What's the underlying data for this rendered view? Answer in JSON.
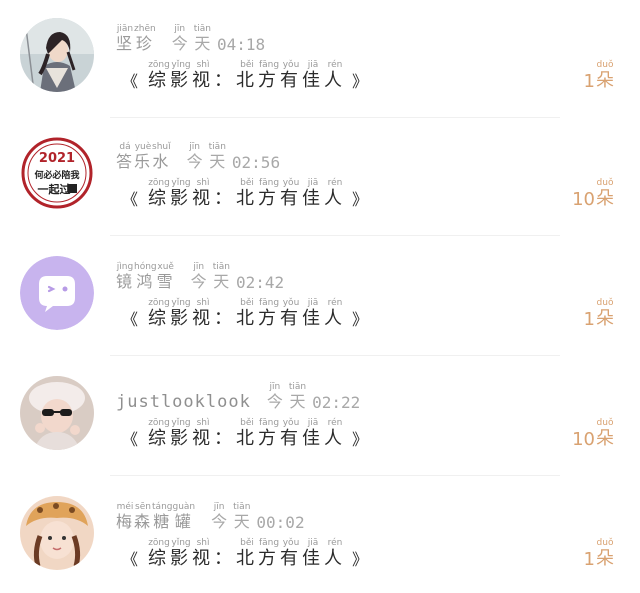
{
  "rows": [
    {
      "name": "坚珍",
      "name_pinyin": [
        "jiān",
        "zhēn"
      ],
      "name_chars": [
        "坚",
        "珍"
      ],
      "time_label": "今天",
      "time_pinyin": [
        "jīn",
        "tiān"
      ],
      "time_chars": [
        "今",
        "天"
      ],
      "timestamp": "04:18",
      "title_open": "《",
      "title_close": "》",
      "title_chars": [
        "综",
        "影",
        "视",
        "：",
        "北",
        "方",
        "有",
        "佳",
        "人"
      ],
      "title_pinyin": [
        "zōng",
        "yǐng",
        "shì",
        "",
        "běi",
        "fāng",
        "yǒu",
        "jiā",
        "rén"
      ],
      "count_number": "1",
      "count_unit": "朵",
      "count_unit_pinyin": "duǒ",
      "avatar_icon": "anime-portrait-avatar"
    },
    {
      "name": "答乐水",
      "name_pinyin": [
        "dá",
        "yuè",
        "shuǐ"
      ],
      "name_chars": [
        "答",
        "乐",
        "水"
      ],
      "time_label": "今天",
      "time_pinyin": [
        "jīn",
        "tiān"
      ],
      "time_chars": [
        "今",
        "天"
      ],
      "timestamp": "02:56",
      "title_open": "《",
      "title_close": "》",
      "title_chars": [
        "综",
        "影",
        "视",
        "：",
        "北",
        "方",
        "有",
        "佳",
        "人"
      ],
      "title_pinyin": [
        "zōng",
        "yǐng",
        "shì",
        "",
        "běi",
        "fāng",
        "yǒu",
        "jiā",
        "rén"
      ],
      "count_number": "10",
      "count_unit": "朵",
      "count_unit_pinyin": "duǒ",
      "avatar_icon": "2021-badge-avatar",
      "avatar_year": "2021",
      "avatar_line1": "何必必陪我",
      "avatar_line2": "一起过"
    },
    {
      "name": "镜鸿雪",
      "name_pinyin": [
        "jìng",
        "hóng",
        "xuě"
      ],
      "name_chars": [
        "镜",
        "鸿",
        "雪"
      ],
      "time_label": "今天",
      "time_pinyin": [
        "jīn",
        "tiān"
      ],
      "time_chars": [
        "今",
        "天"
      ],
      "timestamp": "02:42",
      "title_open": "《",
      "title_close": "》",
      "title_chars": [
        "综",
        "影",
        "视",
        "：",
        "北",
        "方",
        "有",
        "佳",
        "人"
      ],
      "title_pinyin": [
        "zōng",
        "yǐng",
        "shì",
        "",
        "běi",
        "fāng",
        "yǒu",
        "jiā",
        "rén"
      ],
      "count_number": "1",
      "count_unit": "朵",
      "count_unit_pinyin": "duǒ",
      "avatar_icon": "chat-bubble-wink-avatar"
    },
    {
      "name": "justlooklook",
      "latin": true,
      "time_label": "今天",
      "time_pinyin": [
        "jīn",
        "tiān"
      ],
      "time_chars": [
        "今",
        "天"
      ],
      "timestamp": "02:22",
      "title_open": "《",
      "title_close": "》",
      "title_chars": [
        "综",
        "影",
        "视",
        "：",
        "北",
        "方",
        "有",
        "佳",
        "人"
      ],
      "title_pinyin": [
        "zōng",
        "yǐng",
        "shì",
        "",
        "běi",
        "fāng",
        "yǒu",
        "jiā",
        "rén"
      ],
      "count_number": "10",
      "count_unit": "朵",
      "count_unit_pinyin": "duǒ",
      "avatar_icon": "girl-with-sunglasses-avatar"
    },
    {
      "name": "梅森糖罐",
      "name_pinyin": [
        "méi",
        "sēn",
        "táng",
        "guàn"
      ],
      "name_chars": [
        "梅",
        "森",
        "糖",
        "罐"
      ],
      "time_label": "今天",
      "time_pinyin": [
        "jīn",
        "tiān"
      ],
      "time_chars": [
        "今",
        "天"
      ],
      "timestamp": "00:02",
      "title_open": "《",
      "title_close": "》",
      "title_chars": [
        "综",
        "影",
        "视",
        "：",
        "北",
        "方",
        "有",
        "佳",
        "人"
      ],
      "title_pinyin": [
        "zōng",
        "yǐng",
        "shì",
        "",
        "běi",
        "fāng",
        "yǒu",
        "jiā",
        "rén"
      ],
      "count_number": "1",
      "count_unit": "朵",
      "count_unit_pinyin": "duǒ",
      "avatar_icon": "girl-with-hat-avatar"
    }
  ]
}
